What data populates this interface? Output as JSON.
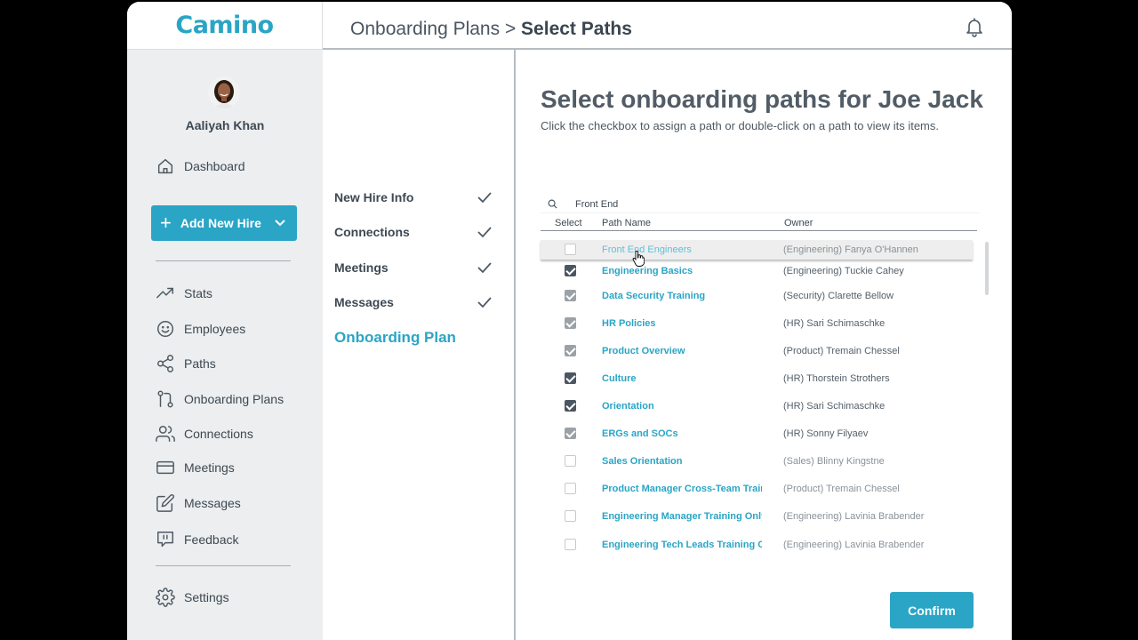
{
  "app": {
    "logo": "Camino"
  },
  "header": {
    "breadcrumb_parent": "Onboarding Plans > ",
    "breadcrumb_current": "Select Paths"
  },
  "user": {
    "name": "Aaliyah Khan"
  },
  "sidebar": {
    "dashboard": "Dashboard",
    "add_new_hire": "Add New Hire",
    "items": [
      {
        "label": "Stats",
        "icon": "trending-up-icon"
      },
      {
        "label": "Employees",
        "icon": "smiley-icon"
      },
      {
        "label": "Paths",
        "icon": "share-icon"
      },
      {
        "label": "Onboarding Plans",
        "icon": "git-branch-icon"
      },
      {
        "label": "Connections",
        "icon": "users-icon"
      },
      {
        "label": "Meetings",
        "icon": "card-icon"
      },
      {
        "label": "Messages",
        "icon": "edit-icon"
      },
      {
        "label": "Feedback",
        "icon": "chat-icon"
      }
    ],
    "settings": "Settings"
  },
  "steps": [
    {
      "label": "New Hire Info",
      "done": true
    },
    {
      "label": "Connections",
      "done": true
    },
    {
      "label": "Meetings",
      "done": true
    },
    {
      "label": "Messages",
      "done": true
    },
    {
      "label": "Onboarding Plan",
      "done": false
    }
  ],
  "main": {
    "title": "Select onboarding paths for Joe Jack",
    "subtitle": "Click the checkbox to assign a path or double-click on a path to view its items.",
    "search_value": "Front End",
    "columns": {
      "select": "Select",
      "path": "Path Name",
      "owner": "Owner"
    },
    "rows": [
      {
        "path": "Front End Engineers",
        "owner": "(Engineering) Fanya O'Hannen",
        "state": "off"
      },
      {
        "path": "Engineering Basics",
        "owner": "(Engineering) Tuckie Cahey",
        "state": "on"
      },
      {
        "path": "Data Security Training",
        "owner": "(Security) Clarette Bellow",
        "state": "dim"
      },
      {
        "path": "HR Policies",
        "owner": "(HR) Sari Schimaschke",
        "state": "dim"
      },
      {
        "path": "Product Overview",
        "owner": "(Product) Tremain Chessel",
        "state": "dim"
      },
      {
        "path": "Culture",
        "owner": "(HR) Thorstein Strothers",
        "state": "on"
      },
      {
        "path": "Orientation",
        "owner": "(HR) Sari Schimaschke",
        "state": "on"
      },
      {
        "path": "ERGs and SOCs",
        "owner": "(HR) Sonny Filyaev",
        "state": "dim"
      },
      {
        "path": "Sales Orientation",
        "owner": "(Sales) Blinny Kingstne",
        "state": "off"
      },
      {
        "path": "Product Manager Cross-Team Training",
        "owner": "(Product) Tremain Chessel",
        "state": "off"
      },
      {
        "path": "Engineering Manager Training Only",
        "owner": "(Engineering) Lavinia Brabender",
        "state": "off"
      },
      {
        "path": "Engineering Tech Leads Training Only",
        "owner": "(Engineering) Lavinia Brabender",
        "state": "off"
      }
    ],
    "confirm": "Confirm"
  }
}
